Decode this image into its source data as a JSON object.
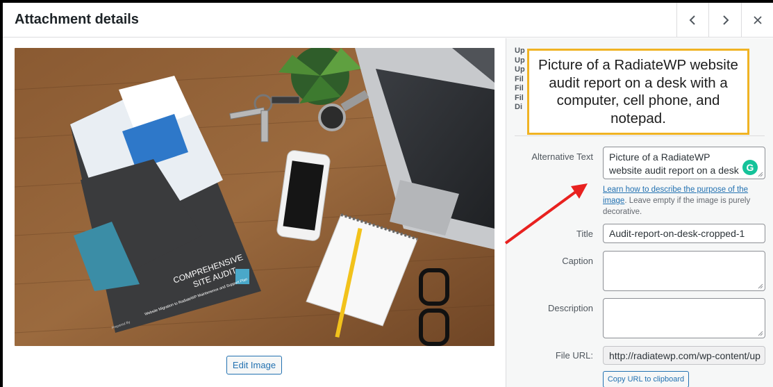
{
  "header": {
    "title": "Attachment details",
    "prev_icon": "chevron-left-icon",
    "next_icon": "chevron-right-icon",
    "close_icon": "close-icon"
  },
  "image": {
    "booklet_title_line1": "COMPREHENSIVE",
    "booklet_title_line2": "SITE AUDIT",
    "booklet_subtitle": "Website Migration to RadiateWP Maintenence and Support Plan",
    "booklet_prepared_by": "Prepared By",
    "edit_button": "Edit Image"
  },
  "meta": {
    "rows": [
      "Up",
      "Up",
      "Up",
      "Fil",
      "Fil",
      "Fil",
      "Di"
    ]
  },
  "fields": {
    "alt_label": "Alternative Text",
    "alt_value": "Picture of a RadiateWP website audit report on a desk with a",
    "help_link": "Learn how to describe the purpose of the image",
    "help_rest": ". Leave empty if the image is purely decorative.",
    "title_label": "Title",
    "title_value": "Audit-report-on-desk-cropped-1",
    "caption_label": "Caption",
    "caption_value": "",
    "description_label": "Description",
    "description_value": "",
    "url_label": "File URL:",
    "url_value": "http://radiatewp.com/wp-content/up",
    "copy_button": "Copy URL to clipboard",
    "grammarly_letter": "G"
  },
  "callout": {
    "text": "Picture of a RadiateWP website audit report on a desk with a computer, cell phone, and notepad."
  },
  "colors": {
    "accent": "#2271b1",
    "callout_border": "#f0b323",
    "arrow": "#e8211f",
    "grammarly": "#15c39a"
  }
}
